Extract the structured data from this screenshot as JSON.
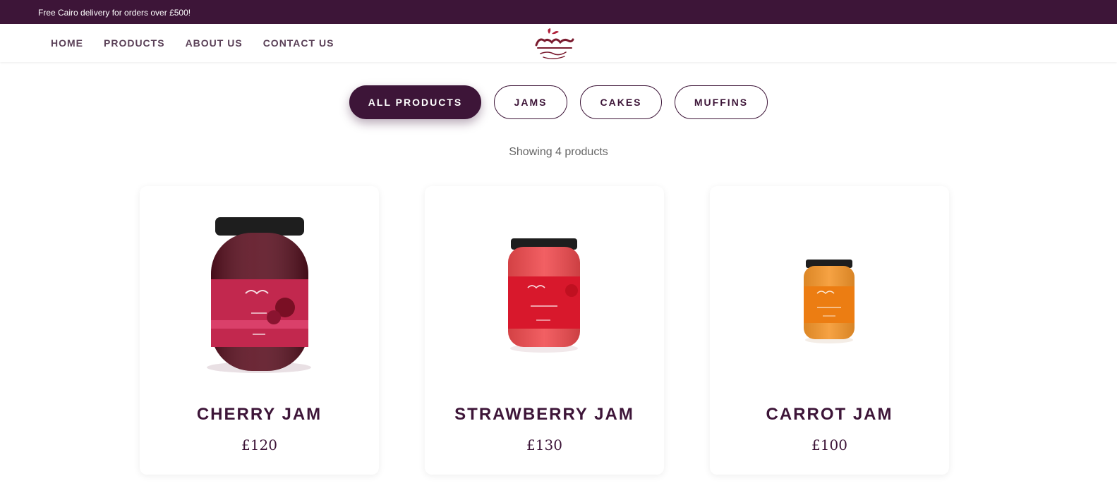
{
  "announcement": "Free Cairo delivery for orders over £500!",
  "nav": {
    "links": [
      "HOME",
      "PRODUCTS",
      "ABOUT US",
      "CONTACT US"
    ]
  },
  "filters": {
    "all": "ALL PRODUCTS",
    "jams": "JAMS",
    "cakes": "CAKES",
    "muffins": "MUFFINS"
  },
  "results_text": "Showing 4 products",
  "products": [
    {
      "name": "CHERRY JAM",
      "price": "£120"
    },
    {
      "name": "STRAWBERRY JAM",
      "price": "£130"
    },
    {
      "name": "CARROT JAM",
      "price": "£100"
    }
  ],
  "colors": {
    "brand": "#3d1538",
    "cherry": "#5c1020",
    "strawberry": "#e0303a",
    "carrot": "#f08a20"
  }
}
